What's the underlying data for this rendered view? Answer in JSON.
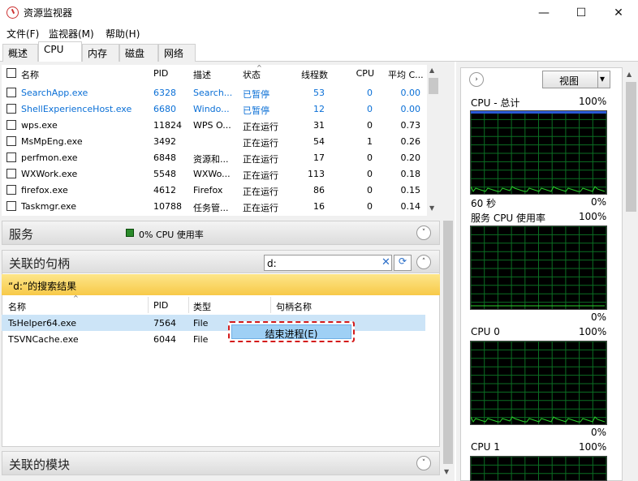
{
  "window": {
    "title": "资源监视器",
    "minimize": "—",
    "maximize": "☐",
    "close": "✕"
  },
  "menu": [
    "文件(F)",
    "监视器(M)",
    "帮助(H)"
  ],
  "tabs": [
    "概述",
    "CPU",
    "内存",
    "磁盘",
    "网络"
  ],
  "process_table": {
    "headers": {
      "name": "名称",
      "pid": "PID",
      "desc": "描述",
      "status": "状态",
      "threads": "线程数",
      "cpu": "CPU",
      "avg": "平均 C..."
    },
    "rows": [
      {
        "name": "SearchApp.exe",
        "pid": "6328",
        "desc": "Search...",
        "status": "已暂停",
        "threads": "53",
        "cpu": "0",
        "avg": "0.00",
        "blue": true
      },
      {
        "name": "ShellExperienceHost.exe",
        "pid": "6680",
        "desc": "Windo...",
        "status": "已暂停",
        "threads": "12",
        "cpu": "0",
        "avg": "0.00",
        "blue": true
      },
      {
        "name": "wps.exe",
        "pid": "11824",
        "desc": "WPS O...",
        "status": "正在运行",
        "threads": "31",
        "cpu": "0",
        "avg": "0.73",
        "blue": false
      },
      {
        "name": "MsMpEng.exe",
        "pid": "3492",
        "desc": "",
        "status": "正在运行",
        "threads": "54",
        "cpu": "1",
        "avg": "0.26",
        "blue": false
      },
      {
        "name": "perfmon.exe",
        "pid": "6848",
        "desc": "资源和...",
        "status": "正在运行",
        "threads": "17",
        "cpu": "0",
        "avg": "0.20",
        "blue": false
      },
      {
        "name": "WXWork.exe",
        "pid": "5548",
        "desc": "WXWo...",
        "status": "正在运行",
        "threads": "113",
        "cpu": "0",
        "avg": "0.18",
        "blue": false
      },
      {
        "name": "firefox.exe",
        "pid": "4612",
        "desc": "Firefox",
        "status": "正在运行",
        "threads": "86",
        "cpu": "0",
        "avg": "0.15",
        "blue": false
      },
      {
        "name": "Taskmgr.exe",
        "pid": "10788",
        "desc": "任务管...",
        "status": "正在运行",
        "threads": "16",
        "cpu": "0",
        "avg": "0.14",
        "blue": false
      }
    ]
  },
  "services": {
    "title": "服务",
    "usage": "0% CPU 使用率"
  },
  "handles": {
    "title": "关联的句柄",
    "search_value": "d:",
    "result_label": "“d:”的搜索结果",
    "headers": {
      "name": "名称",
      "pid": "PID",
      "type": "类型",
      "handle": "句柄名称"
    },
    "rows": [
      {
        "name": "TsHelper64.exe",
        "pid": "7564",
        "type": "File"
      },
      {
        "name": "TSVNCache.exe",
        "pid": "6044",
        "type": "File"
      }
    ],
    "context_item": "结束进程(E)"
  },
  "modules": {
    "title": "关联的模块"
  },
  "right_panel": {
    "view_label": "视图",
    "graphs": [
      {
        "title": "CPU - 总计",
        "max": "100%",
        "foot_left": "60 秒",
        "foot_right": "0%"
      },
      {
        "title": "服务 CPU 使用率",
        "max": "100%",
        "foot_left": "",
        "foot_right": "0%"
      },
      {
        "title": "CPU 0",
        "max": "100%",
        "foot_left": "",
        "foot_right": "0%"
      },
      {
        "title": "CPU 1",
        "max": "100%",
        "foot_left": "",
        "foot_right": ""
      }
    ]
  },
  "colors": {
    "accent_blue": "#0a6fd6",
    "graph_green": "#2bd12b",
    "grid": "#0b6e23",
    "search_bar": "#f7c948"
  }
}
